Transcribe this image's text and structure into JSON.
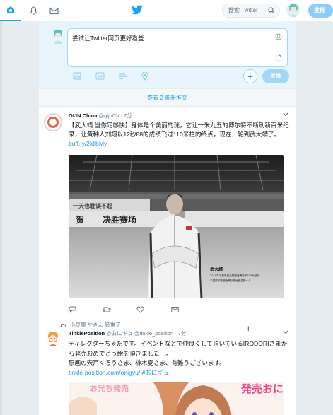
{
  "topbar": {
    "home_icon": "home-icon",
    "notifications_icon": "bell-icon",
    "messages_icon": "envelope-icon",
    "logo_icon": "twitter-bird-icon",
    "search_placeholder": "搜索 Twitter",
    "tweet_button": "发推"
  },
  "compose": {
    "placeholder_text": "尝试让Twitter网页更好看些",
    "send_label": "发推",
    "add_label": "+",
    "tools": [
      "image-icon",
      "gif-icon",
      "poll-icon",
      "location-icon"
    ]
  },
  "new_tweets_bar": "查看 2 条新推文",
  "tweets": [
    {
      "name": "GIJN China",
      "handle": "@gijnCh",
      "time": "· 7分",
      "text": "【武大靖 当你足够快】身体是个美丽的谜，它让一米九五的博尔特不断刷新百米纪录，让黄种人刘翔以12秒88的成绩飞过110米栏的终点，现在，轮到武大靖了。",
      "link": "buff.ly/2kllbMy",
      "photo": {
        "banner_left": "一天也耽误不起",
        "banner_center": "决胜赛场",
        "banner_center_prefix": "贺",
        "caption_title": "武大靖",
        "caption_line1": "2018年平昌冬奥会短道速滑男子500米冠军",
        "caption_line2": "中国男子短道速滑队奥运首金第一人"
      }
    },
    {
      "retweeted_by": "小豆原 やきん 转推了",
      "name": "TinklePosition",
      "handle": "@おにギュ @tinkle_position",
      "time": "· 7分",
      "text_lines": [
        "ディレクターちゃたです。イベントなどで仲良くして頂いているIRODORIさまから発売おめでとう絵を頂きましたー。",
        "原画の宍戸くろうさま、榊木夏さま、有難うございます。"
      ],
      "link": "tinkle-position.com/onigyu/ #おにギュ",
      "image": {
        "left_text": "お兄ち発売",
        "right_text": "発売おに"
      }
    }
  ],
  "colors": {
    "accent": "#1da1f2",
    "compose_bg": "#e8f5fd",
    "link": "#1b95e0"
  }
}
